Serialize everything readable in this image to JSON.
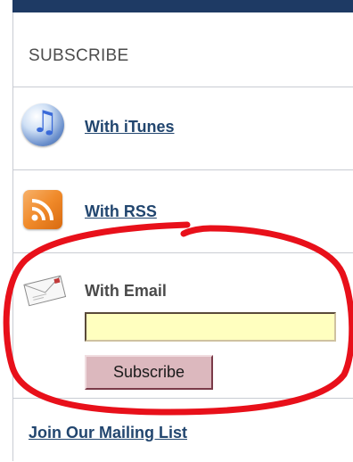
{
  "subscribe_panel": {
    "heading": "SUBSCRIBE",
    "itunes": {
      "label": "With iTunes",
      "icon": "itunes-icon"
    },
    "rss": {
      "label": "With RSS",
      "icon": "rss-feed-icon"
    },
    "email": {
      "label": "With Email",
      "icon": "envelope-icon",
      "input_value": "",
      "input_placeholder": "",
      "button_label": "Subscribe"
    },
    "mailing_list_label": "Join Our Mailing List"
  },
  "colors": {
    "top_bar": "#1e3a64",
    "link": "#22466f",
    "input_background": "#ffffbf",
    "button_background": "#dcb8be",
    "annotation_ring": "#e8101a"
  }
}
